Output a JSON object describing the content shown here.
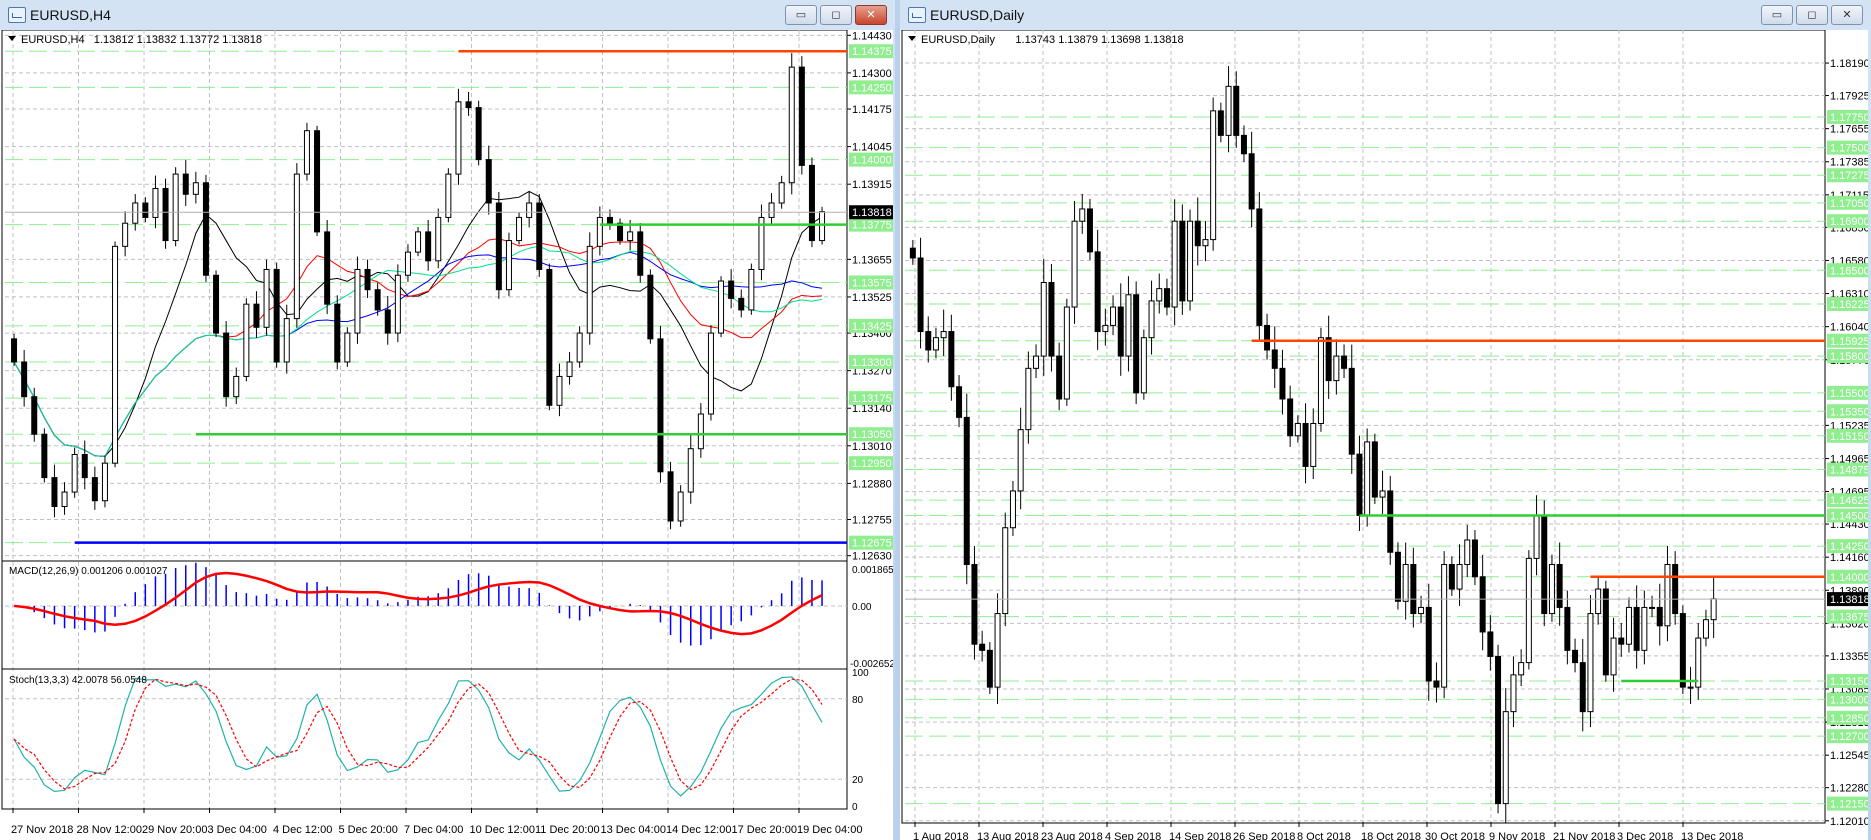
{
  "windows": [
    {
      "title": "EURUSD,H4",
      "buttons": {
        "minimize": "▭",
        "maximize": "◻",
        "close": "✕"
      }
    },
    {
      "title": "EURUSD,Daily",
      "buttons": {
        "minimize": "▭",
        "maximize": "◻",
        "close": "✕"
      }
    }
  ],
  "colors": {
    "bull_fill": "#ffffff",
    "bear_fill": "#000000",
    "resistance": "#ff4500",
    "support": "#32cd32",
    "low_line": "#0000ff",
    "level_label_bg": "#90ee90",
    "price_label_bg": "#000000"
  },
  "chart_data": [
    {
      "type": "candlestick",
      "title": "EURUSD,H4",
      "info": "1.13812 1.13832 1.13772 1.13818",
      "current_price": "1.13818",
      "ylim": [
        1.12615,
        1.14438
      ],
      "y_ticks": [
        "1.14430",
        "1.14300",
        "1.14175",
        "1.14045",
        "1.13915",
        "1.13655",
        "1.13525",
        "1.13400",
        "1.13270",
        "1.13140",
        "1.13010",
        "1.12880",
        "1.12755",
        "1.12630"
      ],
      "level_labels": [
        "1.14375",
        "1.14250",
        "1.14000",
        "1.13775",
        "1.13575",
        "1.13425",
        "1.13300",
        "1.13175",
        "1.13050",
        "1.12950",
        "1.12675"
      ],
      "x_labels": [
        "27 Nov 2018",
        "28 Nov 12:00",
        "29 Nov 20:00",
        "3 Dec 04:00",
        "4 Dec 12:00",
        "5 Dec 20:00",
        "7 Dec 04:00",
        "10 Dec 12:00",
        "11 Dec 20:00",
        "13 Dec 04:00",
        "14 Dec 12:00",
        "17 Dec 20:00",
        "19 Dec 04:00"
      ],
      "closes": [
        1.133,
        1.1318,
        1.1305,
        1.129,
        1.128,
        1.1285,
        1.1298,
        1.129,
        1.1282,
        1.1295,
        1.137,
        1.1378,
        1.1385,
        1.138,
        1.139,
        1.1372,
        1.1395,
        1.1388,
        1.1392,
        1.136,
        1.134,
        1.1318,
        1.1325,
        1.135,
        1.1342,
        1.1362,
        1.133,
        1.1345,
        1.1395,
        1.141,
        1.1375,
        1.135,
        1.133,
        1.134,
        1.1362,
        1.1355,
        1.1348,
        1.134,
        1.136,
        1.1368,
        1.1375,
        1.1365,
        1.138,
        1.1395,
        1.142,
        1.1418,
        1.14,
        1.1385,
        1.1355,
        1.1372,
        1.138,
        1.1385,
        1.1362,
        1.1315,
        1.1325,
        1.133,
        1.134,
        1.137,
        1.138,
        1.1378,
        1.1372,
        1.1375,
        1.136,
        1.1338,
        1.1292,
        1.1275,
        1.1285,
        1.13,
        1.1312,
        1.134,
        1.1358,
        1.1352,
        1.1348,
        1.1362,
        1.138,
        1.1385,
        1.1392,
        1.1432,
        1.1398,
        1.1372,
        1.1382
      ],
      "trend_lines": [
        {
          "price": 1.14375,
          "from_bar": 44,
          "color": "#ff4500"
        },
        {
          "price": 1.13775,
          "from_bar": 58,
          "color": "#32cd32"
        },
        {
          "price": 1.1305,
          "from_bar": 18,
          "color": "#32cd32"
        },
        {
          "price": 1.12675,
          "from_bar": 6,
          "color": "#0000ff"
        }
      ],
      "moving_averages": [
        {
          "period": 10,
          "color": "#000000"
        },
        {
          "period": 21,
          "color": "#ff0000"
        },
        {
          "period": 34,
          "color": "#0000ff"
        },
        {
          "period": 28,
          "color": "#00e08a"
        }
      ],
      "macd": {
        "label": "MACD(12,26,9) 0.001206 0.001027",
        "max_label": "0.001865",
        "zero_label": "0.00",
        "min_label": "-0.002652",
        "ylim": [
          -0.002652,
          0.001865
        ]
      },
      "stoch": {
        "label": "Stoch(13,3,3) 42.0078 56.0548",
        "ticks": [
          "100",
          "80",
          "20",
          "0"
        ]
      }
    },
    {
      "type": "candlestick",
      "title": "EURUSD,Daily",
      "info": "1.13743 1.13879 1.13698 1.13818",
      "current_price": "1.13818",
      "ylim": [
        1.12,
        1.18435
      ],
      "y_ticks": [
        "1.18190",
        "1.17925",
        "1.17655",
        "1.17385",
        "1.17115",
        "1.16850",
        "1.16580",
        "1.16310",
        "1.16040",
        "1.15770",
        "1.15235",
        "1.14965",
        "1.14695",
        "1.14430",
        "1.14160",
        "1.13890",
        "1.13620",
        "1.13355",
        "1.13085",
        "1.12815",
        "1.12545",
        "1.12280",
        "1.12010"
      ],
      "level_labels": [
        "1.17750",
        "1.17500",
        "1.17275",
        "1.17050",
        "1.16900",
        "1.16500",
        "1.16225",
        "1.15925",
        "1.15800",
        "1.15500",
        "1.15350",
        "1.15150",
        "1.14875",
        "1.14625",
        "1.14500",
        "1.14250",
        "1.14000",
        "1.13675",
        "1.13150",
        "1.13000",
        "1.12850",
        "1.12700",
        "1.12150"
      ],
      "x_labels": [
        "1 Aug 2018",
        "13 Aug 2018",
        "23 Aug 2018",
        "4 Sep 2018",
        "14 Sep 2018",
        "26 Sep 2018",
        "8 Oct 2018",
        "18 Oct 2018",
        "30 Oct 2018",
        "9 Nov 2018",
        "21 Nov 2018",
        "3 Dec 2018",
        "13 Dec 2018"
      ],
      "closes": [
        1.166,
        1.16,
        1.1585,
        1.1595,
        1.16,
        1.1555,
        1.153,
        1.141,
        1.1345,
        1.134,
        1.131,
        1.137,
        1.144,
        1.147,
        1.152,
        1.157,
        1.158,
        1.164,
        1.158,
        1.1545,
        1.162,
        1.169,
        1.17,
        1.1665,
        1.16,
        1.1605,
        1.162,
        1.158,
        1.163,
        1.155,
        1.1595,
        1.1625,
        1.1635,
        1.162,
        1.169,
        1.1625,
        1.169,
        1.167,
        1.1675,
        1.178,
        1.176,
        1.18,
        1.176,
        1.1745,
        1.17,
        1.1605,
        1.1585,
        1.157,
        1.1545,
        1.1515,
        1.1525,
        1.149,
        1.1525,
        1.1595,
        1.156,
        1.158,
        1.157,
        1.15,
        1.145,
        1.151,
        1.1465,
        1.147,
        1.142,
        1.138,
        1.141,
        1.137,
        1.1375,
        1.1315,
        1.131,
        1.141,
        1.139,
        1.141,
        1.143,
        1.14,
        1.1355,
        1.1335,
        1.1215,
        1.129,
        1.132,
        1.133,
        1.1415,
        1.145,
        1.137,
        1.141,
        1.1375,
        1.134,
        1.133,
        1.129,
        1.137,
        1.139,
        1.132,
        1.135,
        1.1345,
        1.1375,
        1.134,
        1.1375,
        1.1375,
        1.136,
        1.141,
        1.137,
        1.131,
        1.131,
        1.135,
        1.1365,
        1.1382
      ],
      "trend_lines": [
        {
          "price": 1.15925,
          "from_bar": 44,
          "color": "#ff4500"
        },
        {
          "price": 1.145,
          "from_bar": 58,
          "color": "#32cd32"
        },
        {
          "price": 1.14,
          "from_bar": 88,
          "color": "#ff4500"
        },
        {
          "price": 1.1315,
          "from_bar": 92,
          "to_bar": 102,
          "color": "#32cd32"
        }
      ]
    }
  ]
}
